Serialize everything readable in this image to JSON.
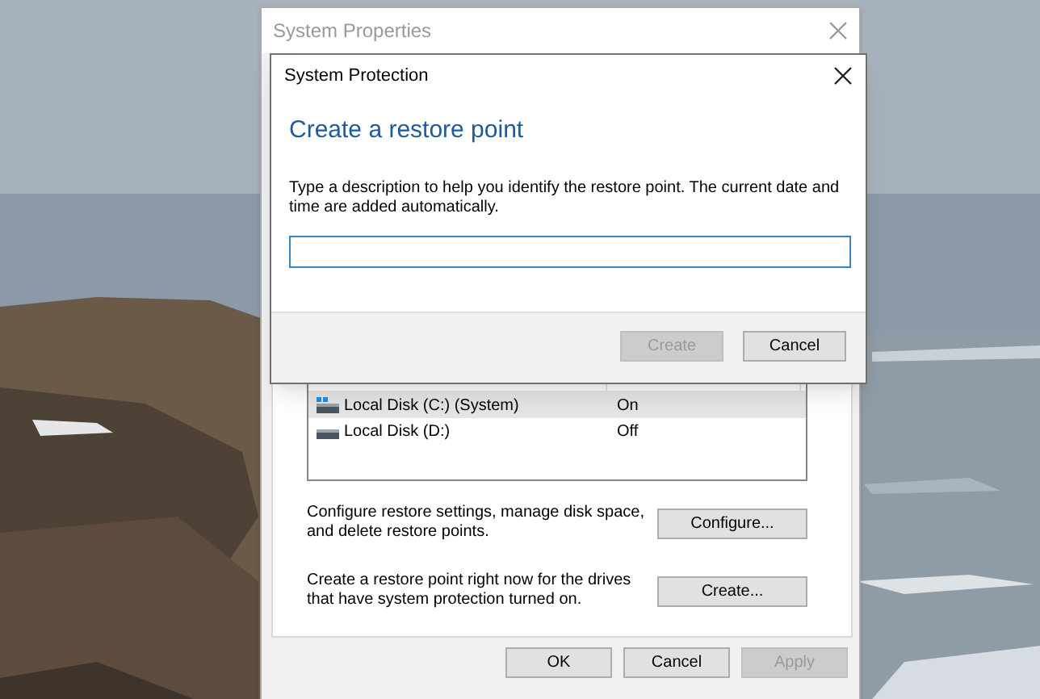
{
  "system_properties": {
    "title": "System Properties",
    "drives_list": {
      "rows": [
        {
          "kind": "system",
          "name": "Local Disk (C:) (System)",
          "protection": "On",
          "selected": true
        },
        {
          "kind": "disk",
          "name": "Local Disk (D:)",
          "protection": "Off",
          "selected": false
        }
      ]
    },
    "actions": [
      {
        "text": "Configure restore settings, manage disk space, and delete restore points.",
        "button": "Configure..."
      },
      {
        "text": "Create a restore point right now for the drives that have system protection turned on.",
        "button": "Create..."
      }
    ],
    "buttons": [
      {
        "label": "OK",
        "disabled": false
      },
      {
        "label": "Cancel",
        "disabled": false
      },
      {
        "label": "Apply",
        "disabled": true
      }
    ]
  },
  "dialog": {
    "title": "System Protection",
    "heading": "Create a restore point",
    "description": "Type a description to help you identify the restore point. The current date and time are added automatically.",
    "buttons": [
      {
        "label": "Create",
        "disabled": true
      },
      {
        "label": "Cancel",
        "disabled": false
      }
    ]
  }
}
